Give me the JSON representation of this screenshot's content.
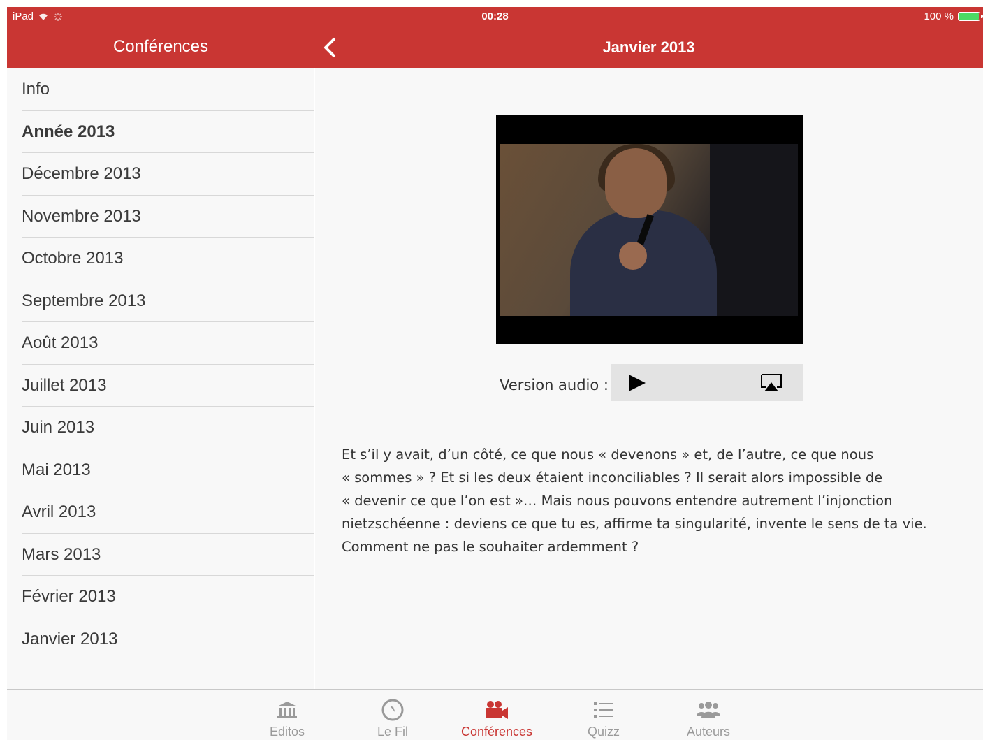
{
  "status_bar": {
    "device": "iPad",
    "time": "00:28",
    "battery": "100 %"
  },
  "nav": {
    "left_title": "Conférences",
    "right_title": "Janvier 2013",
    "back_icon": "chevron-left-icon"
  },
  "sidebar": {
    "items": [
      {
        "label": "Info",
        "bold": false
      },
      {
        "label": "Année 2013",
        "bold": true
      },
      {
        "label": "Décembre 2013",
        "bold": false
      },
      {
        "label": "Novembre 2013",
        "bold": false
      },
      {
        "label": "Octobre 2013",
        "bold": false
      },
      {
        "label": "Septembre 2013",
        "bold": false
      },
      {
        "label": "Août 2013",
        "bold": false
      },
      {
        "label": "Juillet 2013",
        "bold": false
      },
      {
        "label": "Juin 2013",
        "bold": false
      },
      {
        "label": "Mai 2013",
        "bold": false
      },
      {
        "label": "Avril 2013",
        "bold": false
      },
      {
        "label": "Mars 2013",
        "bold": false
      },
      {
        "label": "Février 2013",
        "bold": false
      },
      {
        "label": "Janvier 2013",
        "bold": false
      }
    ]
  },
  "detail": {
    "audio_label": "Version audio :",
    "description_lines": [
      "Et s’il y avait, d’un côté, ce que nous « devenons » et, de l’autre, ce que nous",
      "« sommes » ? Et si les deux étaient inconciliables ? Il serait alors impossible de",
      "« devenir ce que l’on est »… Mais nous pouvons entendre autrement l’injonction",
      "nietzschéenne : deviens ce que tu es, affirme ta singularité, invente le sens de ta vie.",
      "Comment ne pas le souhaiter ardemment ?"
    ]
  },
  "tabbar": {
    "tabs": [
      {
        "label": "Editos",
        "icon": "bank-icon",
        "active": false
      },
      {
        "label": "Le Fil",
        "icon": "compass-icon",
        "active": false
      },
      {
        "label": "Conférences",
        "icon": "video-camera-icon",
        "active": true
      },
      {
        "label": "Quizz",
        "icon": "list-icon",
        "active": false
      },
      {
        "label": "Auteurs",
        "icon": "users-icon",
        "active": false
      }
    ]
  },
  "colors": {
    "accent": "#c93633",
    "inactive_tab": "#9a9a9a",
    "battery_green": "#4cd964"
  }
}
